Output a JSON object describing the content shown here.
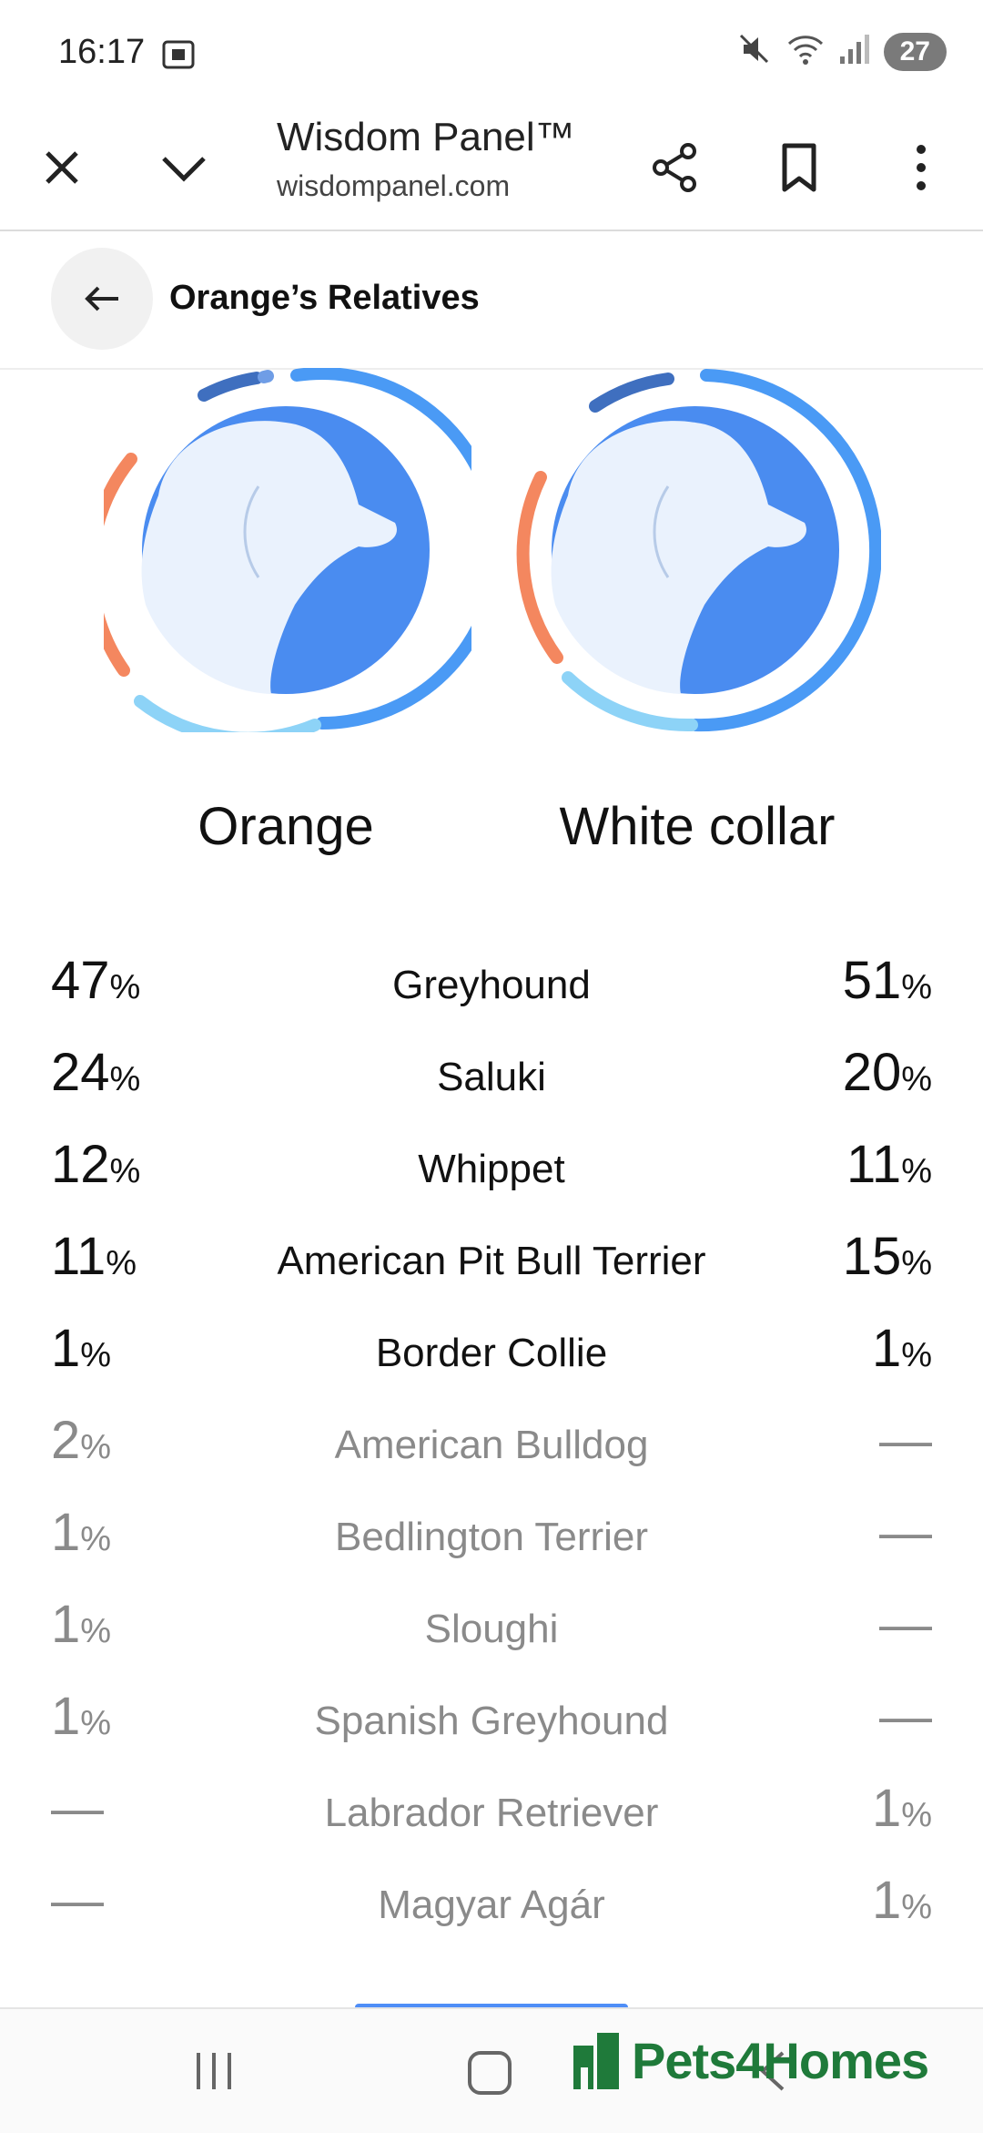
{
  "status_bar": {
    "time": "16:17",
    "battery": "27"
  },
  "browser": {
    "title": "Wisdom Panel™",
    "url": "wisdompanel.com",
    "icons": [
      "close-icon",
      "chevron-down-icon",
      "share-icon",
      "bookmark-icon",
      "more-vert-icon"
    ]
  },
  "page": {
    "title": "Orange’s Relatives",
    "back_icon": "arrow-left-icon"
  },
  "dogs": {
    "left": "Orange",
    "right": "White collar"
  },
  "colors": {
    "greyhound": "#4a9af5",
    "saluki": "#f4875f",
    "whippet": "#8dd3f7",
    "pit_bull": "#3f6fbf",
    "muted_text": "#8a8a8a"
  },
  "breeds": [
    {
      "left": "47",
      "name": "Greyhound",
      "right": "51",
      "muted": false
    },
    {
      "left": "24",
      "name": "Saluki",
      "right": "20",
      "muted": false
    },
    {
      "left": "12",
      "name": "Whippet",
      "right": "11",
      "muted": false
    },
    {
      "left": "11",
      "name": "American Pit Bull Terrier",
      "right": "15",
      "muted": false
    },
    {
      "left": "1",
      "name": "Border Collie",
      "right": "1",
      "muted": false
    },
    {
      "left": "2",
      "name": "American Bulldog",
      "right": "—",
      "muted": true
    },
    {
      "left": "1",
      "name": "Bedlington Terrier",
      "right": "—",
      "muted": true
    },
    {
      "left": "1",
      "name": "Sloughi",
      "right": "—",
      "muted": true
    },
    {
      "left": "1",
      "name": "Spanish Greyhound",
      "right": "—",
      "muted": true
    },
    {
      "left": "—",
      "name": "Labrador Retriever",
      "right": "1",
      "muted": true
    },
    {
      "left": "—",
      "name": "Magyar Agár",
      "right": "1",
      "muted": true
    }
  ],
  "percent_sign": "%",
  "watermark": "Pets4Homes",
  "nav": [
    "recents-icon",
    "home-icon",
    "back-icon"
  ]
}
